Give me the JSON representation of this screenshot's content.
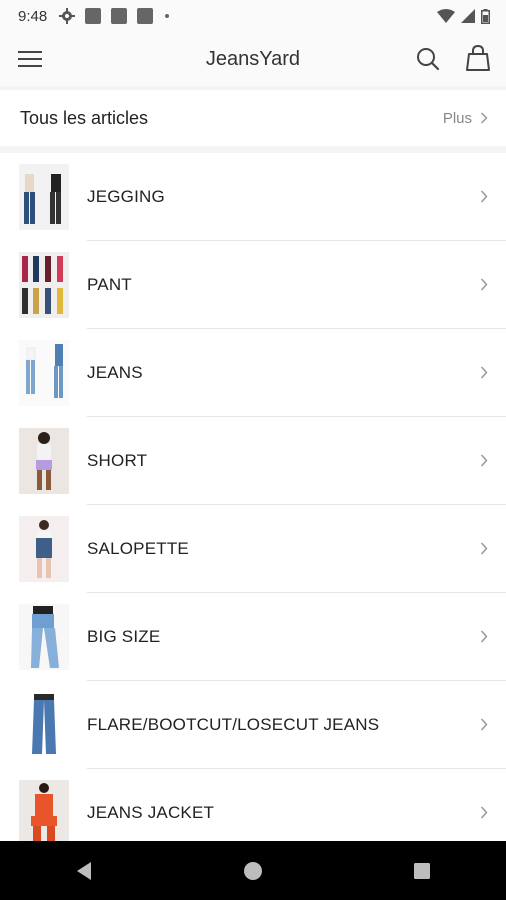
{
  "status_bar": {
    "time": "9:48"
  },
  "app_bar": {
    "title": "JeansYard"
  },
  "section": {
    "title": "Tous les articles",
    "more_label": "Plus"
  },
  "categories": [
    {
      "label": "JEGGING"
    },
    {
      "label": "PANT"
    },
    {
      "label": "JEANS"
    },
    {
      "label": "SHORT"
    },
    {
      "label": "SALOPETTE"
    },
    {
      "label": "BIG SIZE"
    },
    {
      "label": "FLARE/BOOTCUT/LOSECUT JEANS"
    },
    {
      "label": "JEANS JACKET"
    }
  ],
  "colors": {
    "accent_text": "#222222",
    "muted_text": "#888888",
    "divider": "#e6e6e6",
    "nav_bar": "#000000"
  },
  "icons": {
    "menu": "hamburger-icon",
    "search": "search-icon",
    "bag": "shopping-bag-icon",
    "chevron": "chevron-right-icon",
    "nav_back": "back-triangle-icon",
    "nav_home": "home-circle-icon",
    "nav_recents": "recents-square-icon"
  }
}
